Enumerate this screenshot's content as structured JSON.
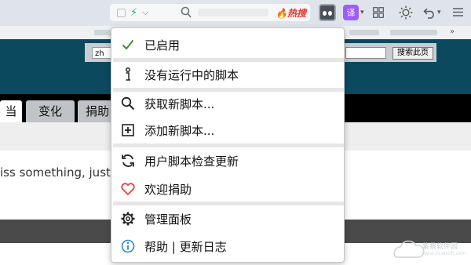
{
  "toolbar": {
    "hot_label": "热搜",
    "icons": [
      "grid-icon",
      "lightning-icon",
      "chevron-down-icon",
      "search-icon",
      "tampermonkey-icon",
      "translate-icon",
      "apps-icon",
      "sun-icon",
      "undo-icon",
      "menu-icon"
    ],
    "translate_glyph": "译",
    "more_glyph": "»",
    "colors": {
      "toolbar_bg": "#dfe4ea",
      "hot": "#e8322c",
      "translate": "#9e5cff",
      "bolt": "#21b35c"
    }
  },
  "page": {
    "lang_select_value": "zh",
    "search_button": "搜索此页",
    "tabs": [
      {
        "label": "当"
      },
      {
        "label": "变化"
      },
      {
        "label": "捐助"
      }
    ],
    "body_text": "iss something, just",
    "watermark": {
      "title": "紫蔡软件园",
      "sub": "www.zicaisoft.com"
    },
    "colors": {
      "header_bg": "#0b4a5e",
      "tabbar_bg": "#000000"
    }
  },
  "popup": {
    "items": [
      {
        "label": "已启用",
        "icon": "check-icon",
        "color": "#3a8e2a"
      },
      {
        "label": "没有运行中的脚本",
        "icon": "info-icon"
      },
      {
        "label": "获取新脚本...",
        "icon": "search-icon"
      },
      {
        "label": "添加新脚本...",
        "icon": "add-icon"
      },
      {
        "label": "用户脚本检查更新",
        "icon": "refresh-icon"
      },
      {
        "label": "欢迎捐助",
        "icon": "heart-icon",
        "color": "#e0453a"
      },
      {
        "label": "管理面板",
        "icon": "gear-icon"
      },
      {
        "label": "帮助 | 更新日志",
        "icon": "info-circle-icon",
        "color": "#2a86d9"
      }
    ]
  }
}
